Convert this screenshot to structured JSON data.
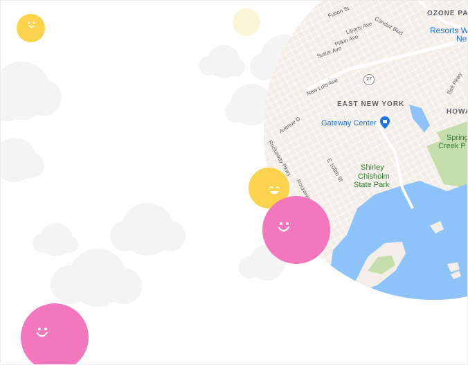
{
  "map": {
    "labels": {
      "fulton": "Fulton St",
      "liberty": "Liberty Ave",
      "pitkin": "Pitkin Ave",
      "sutter": "Sutter Ave",
      "conduit": "Conduit Blvd",
      "new_lots": "New Lots Ave",
      "route": "27",
      "ozone_park": "OZONE PA",
      "resorts_1": "Resorts W",
      "resorts_2": "Ne",
      "belt_pkwy": "Belt Pkwy",
      "east_new_york": "EAST NEW YORK",
      "howard": "HOWA",
      "gateway_center": "Gateway Center",
      "avenue_d": "Avenue D",
      "spring_1": "Spring",
      "spring_2": "Creek P",
      "rockaway_pkwy": "Rockaway Pkwy",
      "e108": "E 108th St",
      "rockaway_ave": "Rockaway",
      "shirley_1": "Shirley",
      "shirley_2": "Chisholm",
      "shirley_3": "State Park"
    },
    "colors": {
      "land": "#f3efe8",
      "water": "#8ec3f9",
      "park": "#c6deab",
      "road": "#ffffff",
      "highway": "#ffffff",
      "label": "#5f6368",
      "park_label": "#2f7d32",
      "poi": "#1a73e8"
    },
    "icons": {
      "poi": "shopping-bag-pin-icon"
    }
  },
  "bubbles": {
    "colors": {
      "yellow": "#fcd34d",
      "pink": "#f277bc",
      "pale_yellow": "#fef6d8"
    },
    "icons": {
      "top_left": "smiley-face-icon",
      "top_pale": "blank-circle",
      "mid_yellow": "laughing-face-icon",
      "mid_pink": "smiley-face-icon",
      "bottom_pink": "smiley-face-icon"
    }
  },
  "background": {
    "cloud_color": "#f4f4f4"
  }
}
